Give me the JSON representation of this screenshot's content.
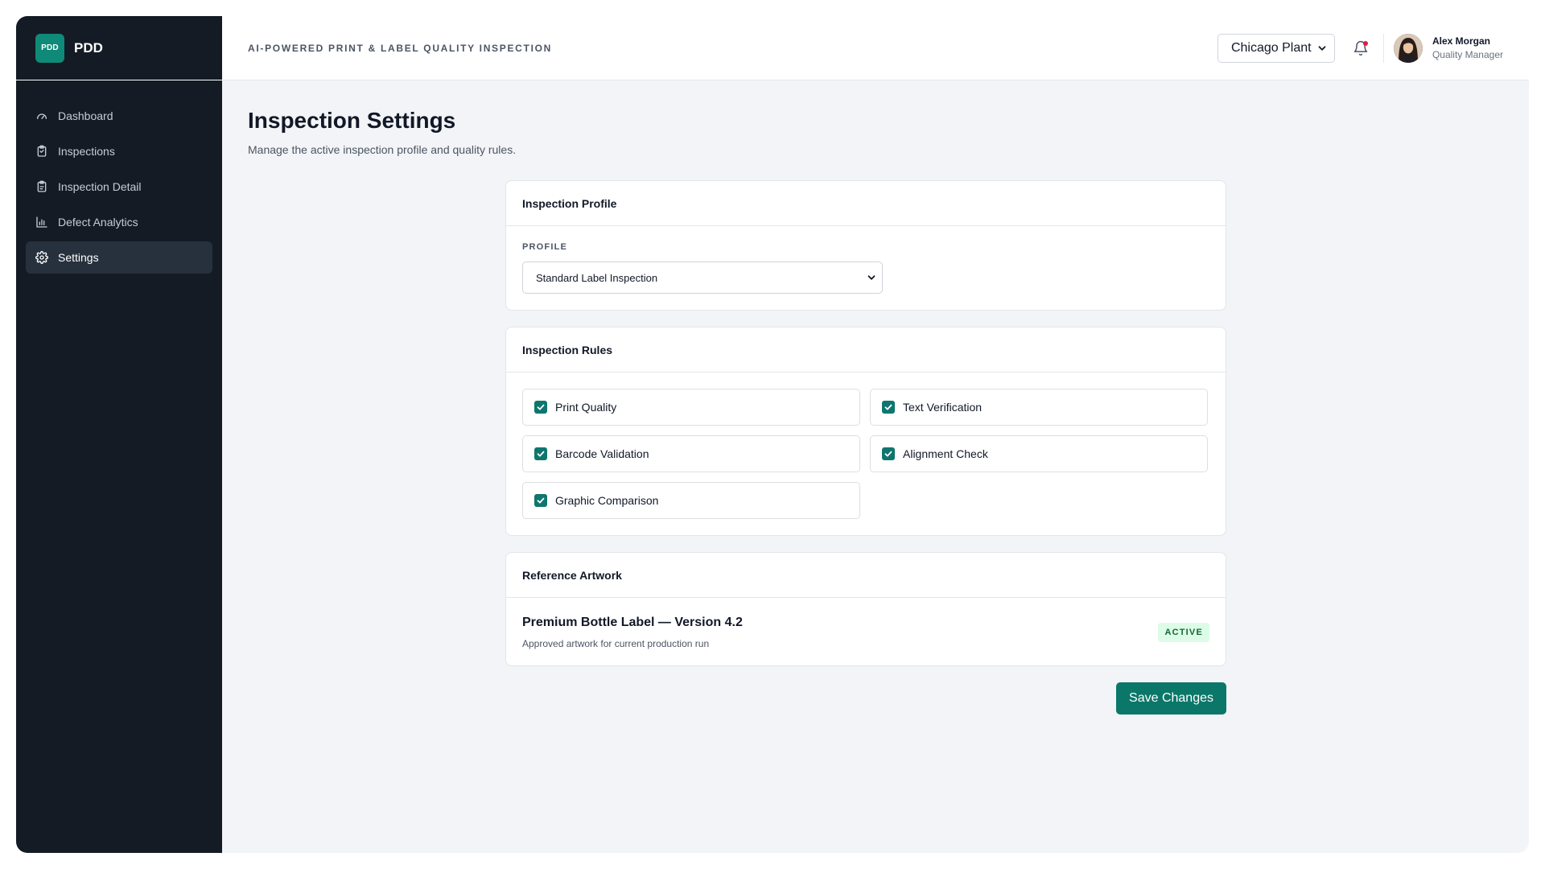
{
  "brand": {
    "logo_text": "PDD",
    "name": "PDD"
  },
  "sidebar": {
    "items": [
      {
        "label": "Dashboard",
        "icon": "gauge-icon",
        "active": false
      },
      {
        "label": "Inspections",
        "icon": "clipboard-icon",
        "active": false
      },
      {
        "label": "Inspection Detail",
        "icon": "clipboard-check-icon",
        "active": false
      },
      {
        "label": "Defect Analytics",
        "icon": "bar-chart-icon",
        "active": false
      },
      {
        "label": "Settings",
        "icon": "gear-icon",
        "active": true
      }
    ]
  },
  "header": {
    "title": "AI-POWERED PRINT & LABEL QUALITY INSPECTION",
    "plant_selected": "Chicago Plant",
    "notifications_unread": true,
    "user": {
      "name": "Alex Morgan",
      "role": "Quality Manager"
    }
  },
  "page": {
    "title": "Inspection Settings",
    "subtitle": "Manage the active inspection profile and quality rules."
  },
  "profile_card": {
    "title": "Inspection Profile",
    "field_label": "PROFILE",
    "selected": "Standard Label Inspection"
  },
  "rules_card": {
    "title": "Inspection Rules",
    "rules": [
      {
        "label": "Print Quality",
        "checked": true
      },
      {
        "label": "Text Verification",
        "checked": true
      },
      {
        "label": "Barcode Validation",
        "checked": true
      },
      {
        "label": "Alignment Check",
        "checked": true
      },
      {
        "label": "Graphic Comparison",
        "checked": true
      }
    ]
  },
  "artwork_card": {
    "title": "Reference Artwork",
    "artwork_name": "Premium Bottle Label — Version 4.2",
    "description": "Approved artwork for current production run",
    "status": "ACTIVE"
  },
  "actions": {
    "save_label": "Save Changes"
  },
  "colors": {
    "sidebar_bg": "#141b24",
    "accent": "#0b7768",
    "badge_bg": "#dcfce7",
    "badge_text": "#166534",
    "notification_dot": "#e11d48"
  }
}
